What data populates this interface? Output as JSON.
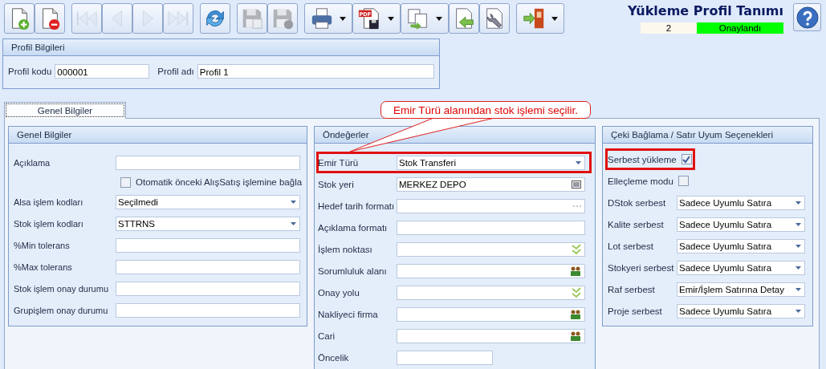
{
  "toolbar": [
    {
      "kind": "new",
      "disabled": false,
      "dropdown": false
    },
    {
      "kind": "delete",
      "disabled": false,
      "dropdown": false
    },
    {
      "kind": "first",
      "disabled": true,
      "dropdown": false
    },
    {
      "kind": "prev",
      "disabled": true,
      "dropdown": false
    },
    {
      "kind": "next",
      "disabled": true,
      "dropdown": false
    },
    {
      "kind": "last",
      "disabled": true,
      "dropdown": false
    },
    {
      "kind": "refresh",
      "disabled": false,
      "dropdown": false
    },
    {
      "kind": "save",
      "disabled": true,
      "dropdown": false
    },
    {
      "kind": "cancel",
      "disabled": true,
      "dropdown": false
    },
    {
      "kind": "print",
      "disabled": false,
      "dropdown": true
    },
    {
      "kind": "pdf",
      "disabled": false,
      "dropdown": true,
      "badge": "PDF"
    },
    {
      "kind": "export",
      "disabled": false,
      "dropdown": true
    },
    {
      "kind": "import",
      "disabled": false,
      "dropdown": false
    },
    {
      "kind": "settings",
      "disabled": false,
      "dropdown": false
    },
    {
      "kind": "exit",
      "disabled": false,
      "dropdown": true
    }
  ],
  "header": {
    "title": "Yükleme Profil Tanımı",
    "number": "2",
    "status": "Onaylandı"
  },
  "profile": {
    "title": "Profil Bilgileri",
    "fields": [
      {
        "label": "Profil kodu",
        "value": "000001"
      },
      {
        "label": "Profil adı",
        "value": "Profil 1"
      }
    ]
  },
  "tabs": [
    {
      "label": "Genel Bilgiler",
      "selected": true
    }
  ],
  "callout": {
    "text": "Emir Türü alanından stok işlemi seçilir."
  },
  "panels": [
    {
      "title": "Genel Bilgiler",
      "rows": [
        {
          "kind": "text",
          "label": "Açıklama",
          "highlighted": false
        },
        {
          "kind": "checkbox",
          "label": "Otomatik önceki AlışSatış işlemine bağla",
          "checked": false,
          "highlighted": false
        },
        {
          "kind": "combo",
          "label": "Alsa işlem kodları",
          "value": "Seçilmedi",
          "highlighted": false
        },
        {
          "kind": "combo",
          "label": "Stok işlem kodları",
          "value": "STTRNS",
          "highlighted": false
        },
        {
          "kind": "text",
          "label": "%Min tolerans",
          "highlighted": false
        },
        {
          "kind": "text",
          "label": "%Max tolerans",
          "highlighted": false
        },
        {
          "kind": "text",
          "label": "Stok işlem onay durumu",
          "highlighted": false
        },
        {
          "kind": "text",
          "label": "Grupişlem onay durumu",
          "highlighted": false
        }
      ]
    },
    {
      "title": "Öndeğerler",
      "rows": [
        {
          "kind": "combo",
          "label": "Emir Türü",
          "value": "Stok Transferi",
          "highlighted": true
        },
        {
          "kind": "browse",
          "label": "Stok yeri",
          "value": "MERKEZ DEPO",
          "highlighted": false
        },
        {
          "kind": "ellipsis",
          "label": "Hedef tarih formatı",
          "highlighted": false
        },
        {
          "kind": "text",
          "label": "Açıklama formatı",
          "highlighted": false
        },
        {
          "kind": "checklist",
          "label": "İşlem noktası",
          "highlighted": false
        },
        {
          "kind": "people",
          "label": "Sorumluluk alanı",
          "highlighted": false
        },
        {
          "kind": "checklist",
          "label": "Onay yolu",
          "highlighted": false
        },
        {
          "kind": "people",
          "label": "Nakliyeci firma",
          "highlighted": false
        },
        {
          "kind": "people",
          "label": "Cari",
          "highlighted": false
        },
        {
          "kind": "short",
          "label": "Öncelik",
          "highlighted": false
        }
      ]
    },
    {
      "title": "Çeki Bağlama / Satır Uyum Seçenekleri",
      "rows": [
        {
          "kind": "inline-check",
          "label": "Serbest yükleme",
          "checked": true,
          "highlighted": true
        },
        {
          "kind": "inline-check",
          "label": "Elleçleme modu",
          "checked": false,
          "highlighted": false
        },
        {
          "kind": "combo",
          "label": "DStok serbest",
          "value": "Sadece Uyumlu Satıra",
          "highlighted": false
        },
        {
          "kind": "combo",
          "label": "Kalite serbest",
          "value": "Sadece Uyumlu Satıra",
          "highlighted": false
        },
        {
          "kind": "combo",
          "label": "Lot serbest",
          "value": "Sadece Uyumlu Satıra",
          "highlighted": false
        },
        {
          "kind": "combo",
          "label": "Stokyeri serbest",
          "value": "Sadece Uyumlu Satıra",
          "highlighted": false
        },
        {
          "kind": "combo",
          "label": "Raf serbest",
          "value": "Emir/İşlem Satırına Detay",
          "highlighted": false
        },
        {
          "kind": "combo",
          "label": "Proje serbest",
          "value": "Sadece Uyumlu Satıra",
          "highlighted": false
        }
      ]
    }
  ]
}
